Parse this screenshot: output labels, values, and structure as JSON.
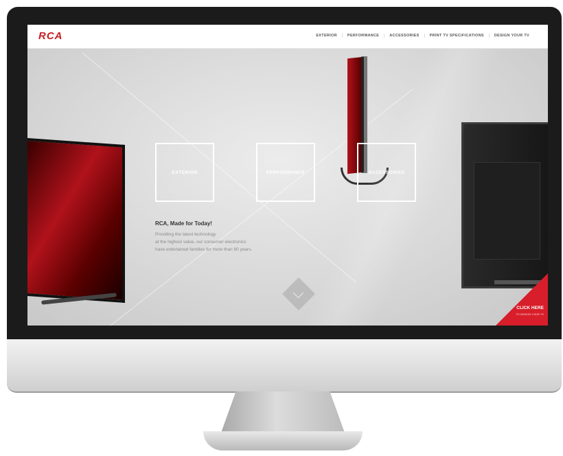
{
  "site": {
    "logo": "RCA",
    "nav": [
      "EXTERIOR",
      "PERFORMANCE",
      "ACCESSORIES",
      "PRINT TV SPECIFICATIONS",
      "DESIGN YOUR TV"
    ]
  },
  "tiles": {
    "exterior": "EXTERIOR",
    "performance": "PERFORMANCE",
    "accessories": "ACCESSORIES"
  },
  "hero": {
    "headline": "RCA, Made for Today!",
    "body": [
      "Providing the latest technology",
      "at the highest value, our consumer electronics",
      "have entertained families for more than 90 years."
    ]
  },
  "cta": {
    "label": "CLICK HERE",
    "sub": "TO DESIGN YOUR TV"
  },
  "colors": {
    "brand": "#c81e24",
    "cta": "#d81e2a",
    "bezel": "#1b1b1b"
  },
  "icons": {
    "scroll": "chevron-down-icon"
  }
}
